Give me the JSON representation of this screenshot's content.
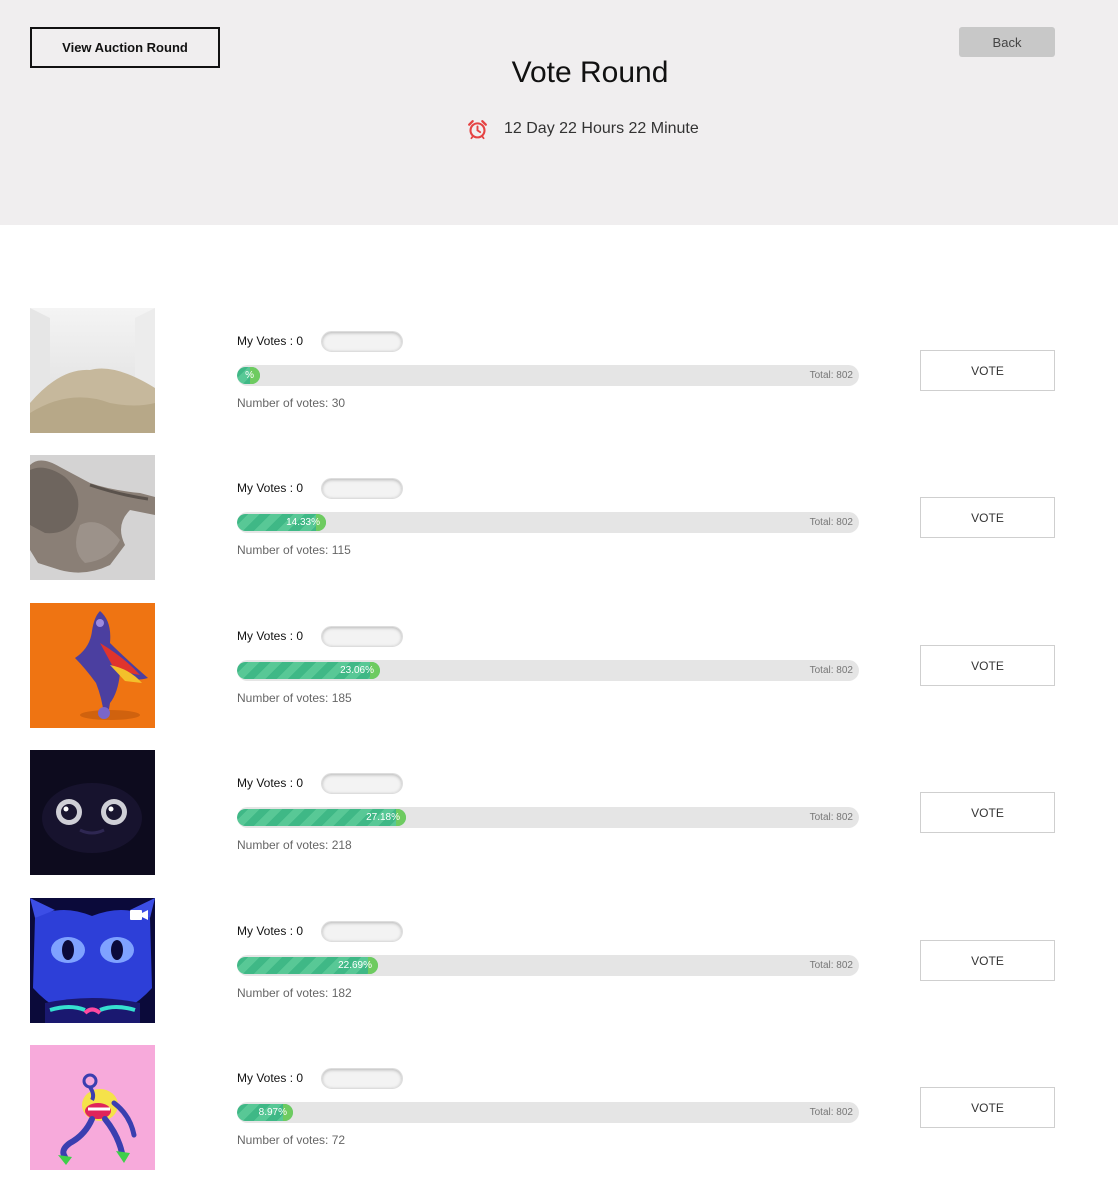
{
  "header": {
    "auction_button": "View Auction Round",
    "back_button": "Back",
    "title": "Vote Round",
    "countdown": "12 Day 22 Hours 22 Minute",
    "timer_icon": "alarm-clock-icon",
    "timer_icon_color": "#e54242"
  },
  "total_label": "Total: 802",
  "entries": [
    {
      "thumbnail": "desert-dunes-room",
      "my_votes": "My Votes : 0",
      "percent_label": "%",
      "percent": 3.74,
      "votes": "Number of votes: 30",
      "vote_button": "VOTE"
    },
    {
      "thumbnail": "driftwood-rock",
      "my_votes": "My Votes : 0",
      "percent_label": "14.33%",
      "percent": 14.33,
      "votes": "Number of votes: 115",
      "vote_button": "VOTE"
    },
    {
      "thumbnail": "purple-creature-orange",
      "my_votes": "My Votes : 0",
      "percent_label": "23.06%",
      "percent": 23.06,
      "votes": "Number of votes: 185",
      "vote_button": "VOTE"
    },
    {
      "thumbnail": "dark-eyes-creature",
      "my_votes": "My Votes : 0",
      "percent_label": "27.18%",
      "percent": 27.18,
      "votes": "Number of votes: 218",
      "vote_button": "VOTE"
    },
    {
      "thumbnail": "blue-demon-face",
      "my_votes": "My Votes : 0",
      "percent_label": "22.69%",
      "percent": 22.69,
      "votes": "Number of votes: 182",
      "vote_button": "VOTE"
    },
    {
      "thumbnail": "pink-monster",
      "my_votes": "My Votes : 0",
      "percent_label": "8.97%",
      "percent": 8.97,
      "votes": "Number of votes: 72",
      "vote_button": "VOTE"
    }
  ],
  "colors": {
    "header_bg": "#f0eeef",
    "progress_fill": "#3fb886",
    "progress_track": "#e5e5e5"
  }
}
